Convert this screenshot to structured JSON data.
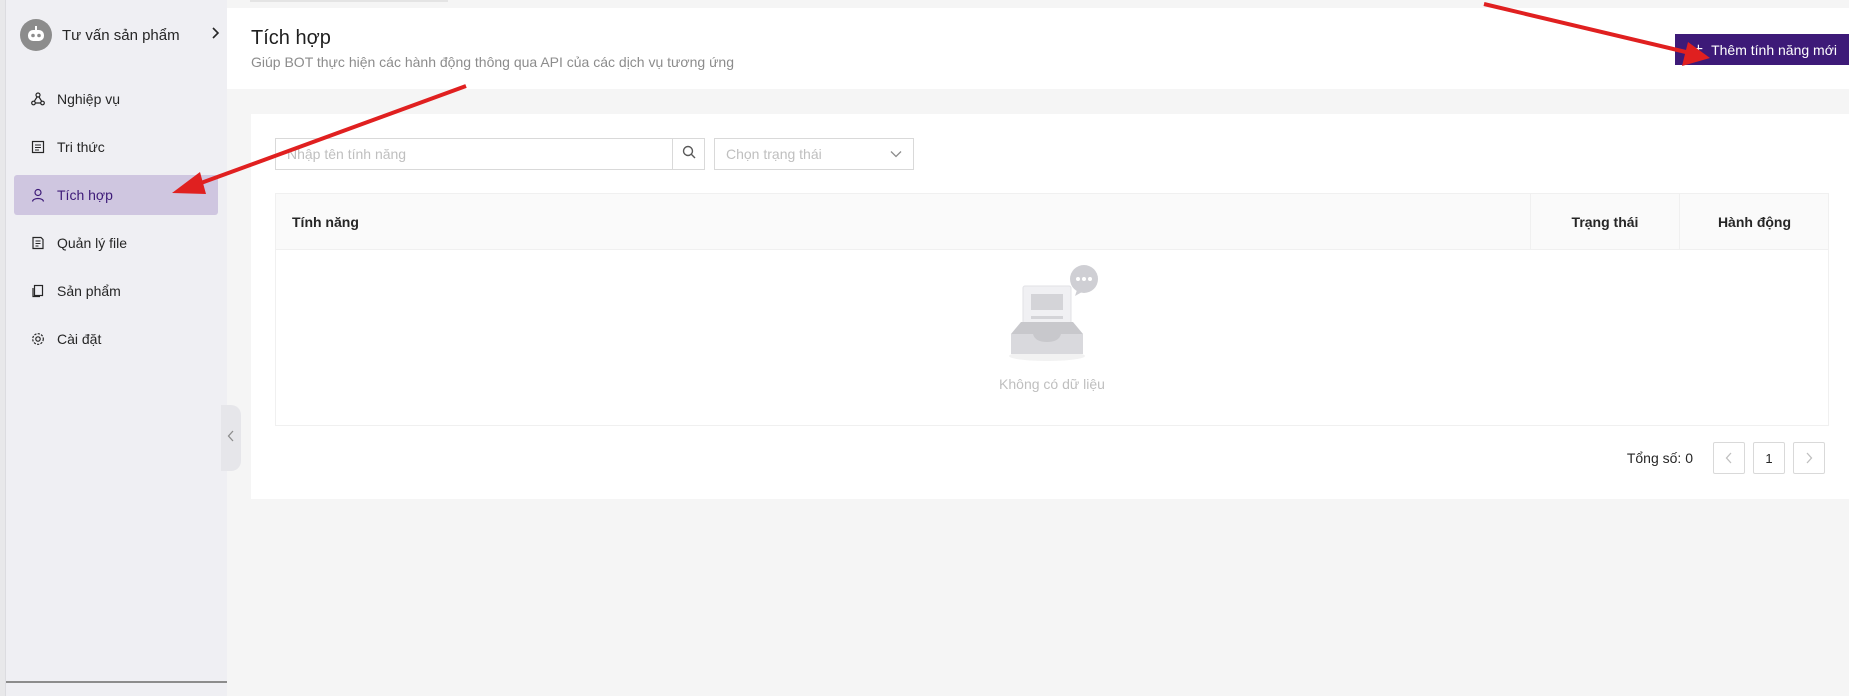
{
  "sidebar": {
    "bot_name": "Tư vấn sản phẩm",
    "items": [
      {
        "label": "Nghiệp vụ",
        "icon": "workflow-icon"
      },
      {
        "label": "Tri thức",
        "icon": "book-icon"
      },
      {
        "label": "Tích hợp",
        "icon": "user-icon",
        "active": true
      },
      {
        "label": "Quản lý file",
        "icon": "file-icon"
      },
      {
        "label": "Sản phẩm",
        "icon": "product-icon"
      },
      {
        "label": "Cài đặt",
        "icon": "gear-icon"
      }
    ]
  },
  "header": {
    "title": "Tích hợp",
    "subtitle": "Giúp BOT thực hiện các hành động thông qua API của các dịch vụ tương ứng",
    "add_button_label": "Thêm tính năng mới"
  },
  "filters": {
    "search_placeholder": "Nhập tên tính năng",
    "status_placeholder": "Chọn trạng thái"
  },
  "table": {
    "columns": [
      "Tính năng",
      "Trạng thái",
      "Hành động"
    ],
    "rows": [],
    "empty_text": "Không có dữ liệu"
  },
  "pagination": {
    "total_label": "Tổng số: 0",
    "current_page": "1"
  },
  "colors": {
    "accent": "#3d1a78",
    "active_menu_bg": "#cfc6e0",
    "annotation_arrow": "#e02020"
  }
}
